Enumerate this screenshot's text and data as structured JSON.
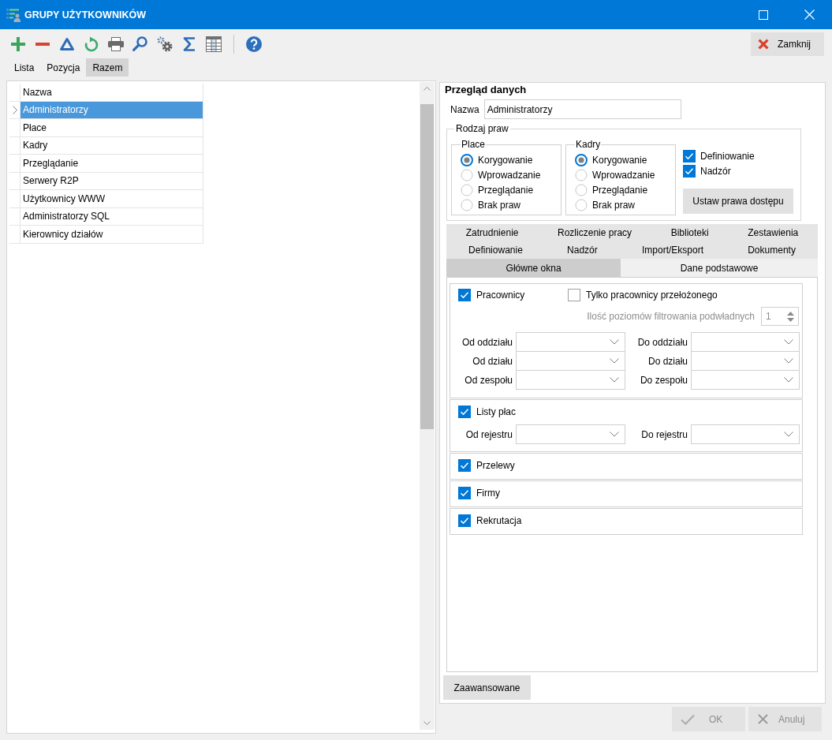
{
  "window": {
    "title": "GRUPY UŻYTKOWNIKÓW"
  },
  "toolbar": {
    "tools": [
      {
        "kind": "add"
      },
      {
        "kind": "remove"
      },
      {
        "kind": "delta"
      },
      {
        "kind": "refresh"
      },
      {
        "kind": "print"
      },
      {
        "kind": "search"
      },
      {
        "kind": "settings"
      },
      {
        "kind": "sum"
      },
      {
        "kind": "columns"
      },
      {
        "kind": "separator"
      },
      {
        "kind": "help"
      }
    ],
    "close_button": {
      "label": "Zamknij"
    }
  },
  "view_tabs": [
    {
      "label": "Lista",
      "selected": false
    },
    {
      "label": "Pozycja",
      "selected": false
    },
    {
      "label": "Razem",
      "selected": true
    }
  ],
  "list": {
    "column": "Nazwa",
    "rows": [
      {
        "name": "Administratorzy",
        "selected": true
      },
      {
        "name": "Płace",
        "selected": false
      },
      {
        "name": "Kadry",
        "selected": false
      },
      {
        "name": "Przeglądanie",
        "selected": false
      },
      {
        "name": "Serwery R2P",
        "selected": false
      },
      {
        "name": "Użytkownicy WWW",
        "selected": false
      },
      {
        "name": "Administratorzy SQL",
        "selected": false
      },
      {
        "name": "Kierownicy działów",
        "selected": false
      }
    ]
  },
  "details": {
    "title": "Przegląd danych",
    "name_field": {
      "label": "Nazwa",
      "value": "Administratorzy"
    },
    "rights": {
      "title": "Rodzaj praw",
      "groups": [
        {
          "title": "Place",
          "options": [
            {
              "label": "Korygowanie",
              "selected": true
            },
            {
              "label": "Wprowadzanie",
              "selected": false
            },
            {
              "label": "Przeglądanie",
              "selected": false
            },
            {
              "label": "Brak praw",
              "selected": false
            }
          ]
        },
        {
          "title": "Kadry",
          "options": [
            {
              "label": "Korygowanie",
              "selected": true
            },
            {
              "label": "Wprowadzanie",
              "selected": false
            },
            {
              "label": "Przeglądanie",
              "selected": false
            },
            {
              "label": "Brak praw",
              "selected": false
            }
          ]
        }
      ],
      "flags": [
        {
          "label": "Definiowanie",
          "checked": true
        },
        {
          "label": "Nadzór",
          "checked": true
        }
      ],
      "button": {
        "label": "Ustaw prawa dostępu"
      }
    },
    "module_tabs": [
      {
        "tabs": [
          {
            "label": "Zatrudnienie",
            "selected": false
          },
          {
            "label": "Rozliczenie pracy",
            "selected": false
          },
          {
            "label": "Biblioteki",
            "selected": false
          },
          {
            "label": "Zestawienia",
            "selected": false
          }
        ]
      },
      {
        "tabs": [
          {
            "label": "Definiowanie",
            "selected": false
          },
          {
            "label": "Nadzór",
            "selected": false
          },
          {
            "label": "Import/Eksport",
            "selected": false
          },
          {
            "label": "Dokumenty",
            "selected": false
          }
        ]
      },
      {
        "tabs": [
          {
            "label": "Główne okna",
            "selected": true
          },
          {
            "label": "Dane podstawowe",
            "selected": false
          }
        ]
      }
    ],
    "sections": [
      {
        "label": "Pracownicy",
        "checked": true,
        "subordinates": {
          "label": "Tylko pracownicy przełożonego",
          "checked": false
        },
        "levels": {
          "label": "Ilość poziomów filtrowania podwładnych",
          "value": "1",
          "disabled": true
        },
        "filters": [
          {
            "from": "Od oddziału",
            "to": "Do oddziału"
          },
          {
            "from": "Od działu",
            "to": "Do działu"
          },
          {
            "from": "Od zespołu",
            "to": "Do zespołu"
          }
        ]
      },
      {
        "label": "Listy płac",
        "checked": true,
        "filters": [
          {
            "from": "Od rejestru",
            "to": "Do rejestru"
          }
        ]
      },
      {
        "label": "Przelewy",
        "checked": true
      },
      {
        "label": "Firmy",
        "checked": true
      },
      {
        "label": "Rekrutacja",
        "checked": true
      }
    ],
    "advanced_button": {
      "label": "Zaawansowane"
    }
  },
  "dialog_buttons": [
    {
      "kind": "ok",
      "label": "OK",
      "disabled": true
    },
    {
      "kind": "cancel",
      "label": "Anuluj",
      "disabled": true
    }
  ]
}
